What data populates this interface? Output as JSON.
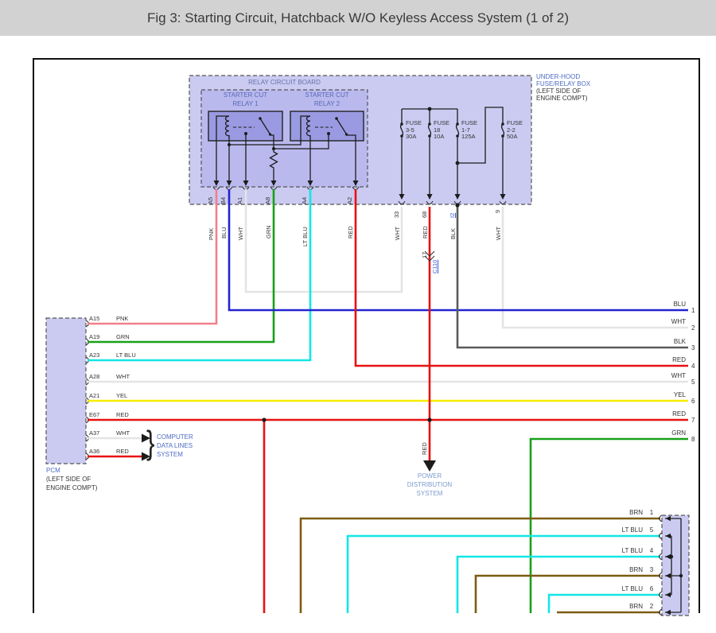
{
  "header": {
    "title": "Fig 3: Starting Circuit, Hatchback W/O Keyless Access System (1 of 2)"
  },
  "colors": {
    "pnk": "#f28089",
    "blu": "#2323d2",
    "wht": "#e4e4e4",
    "grn": "#18a018",
    "ltblu": "#12e6e6",
    "red": "#e81111",
    "yel": "#f6ec00",
    "blk": "#5a5a5a",
    "brn": "#7d5c12",
    "box_fill": "#cbcbf2",
    "board_fill": "#b9b9ee",
    "relay_fill": "#9a9ae2",
    "label_blue": "#4d6cc3",
    "link_blue": "#3c5cd0",
    "power_blue": "#7d9ace",
    "board_label": "#6671a8",
    "relay_label": "#5868b5",
    "line_dark": "#1c1c1c"
  },
  "relay_board": {
    "title": "RELAY CIRCUIT BOARD",
    "relays": [
      {
        "line1": "STARTER CUT",
        "line2": "RELAY 1"
      },
      {
        "line1": "STARTER CUT",
        "line2": "RELAY 2"
      }
    ],
    "pins": [
      {
        "id": "A5",
        "wire": "PNK"
      },
      {
        "id": "B4",
        "wire": "BLU"
      },
      {
        "id": "A1",
        "wire": "WHT"
      },
      {
        "id": "A8",
        "wire": "GRN"
      },
      {
        "id": "A4",
        "wire": "LT BLU"
      },
      {
        "id": "A2",
        "wire": "RED"
      }
    ]
  },
  "fuse_box": {
    "label": [
      "UNDER-HOOD",
      "FUSE/RELAY BOX",
      "(LEFT SIDE OF",
      "ENGINE COMPT)"
    ],
    "fuses": [
      {
        "title": "FUSE",
        "id": "3-5",
        "rating": "30A",
        "pin": "33",
        "wire": "WHT"
      },
      {
        "title": "FUSE",
        "id": "18",
        "rating": "10A",
        "pin": "68",
        "wire": "RED"
      },
      {
        "title": "FUSE",
        "id": "1-7",
        "rating": "125A",
        "pin": "I2",
        "wire": "BLK"
      },
      {
        "title": "FUSE",
        "id": "2-2",
        "rating": "50A",
        "pin": "9",
        "wire": "WHT"
      }
    ]
  },
  "c110": {
    "pin": "17",
    "id": "C110"
  },
  "pcm": {
    "label": [
      "PCM",
      "(LEFT SIDE OF",
      "ENGINE COMPT)"
    ],
    "pins": [
      {
        "id": "A15",
        "wire": "PNK"
      },
      {
        "id": "A19",
        "wire": "GRN"
      },
      {
        "id": "A23",
        "wire": "LT BLU"
      },
      {
        "id": "A28",
        "wire": "WHT"
      },
      {
        "id": "A21",
        "wire": "YEL"
      },
      {
        "id": "E67",
        "wire": "RED"
      },
      {
        "id": "A37",
        "wire": "WHT"
      },
      {
        "id": "A36",
        "wire": "RED"
      }
    ]
  },
  "computer_data": {
    "label": [
      "COMPUTER",
      "DATA LINES",
      "SYSTEM"
    ],
    "brace": "}"
  },
  "power_dist": {
    "label": [
      "POWER",
      "DISTRIBUTION",
      "SYSTEM"
    ]
  },
  "right_wires": [
    {
      "wire": "BLU",
      "num": "1"
    },
    {
      "wire": "WHT",
      "num": "2"
    },
    {
      "wire": "BLK",
      "num": "3"
    },
    {
      "wire": "RED",
      "num": "4"
    },
    {
      "wire": "WHT",
      "num": "5"
    },
    {
      "wire": "YEL",
      "num": "6"
    },
    {
      "wire": "RED",
      "num": "7"
    },
    {
      "wire": "GRN",
      "num": "8"
    }
  ],
  "bottom_wires": [
    {
      "wire": "BRN",
      "num": "1"
    },
    {
      "wire": "LT BLU",
      "num": "5"
    },
    {
      "wire": "LT BLU",
      "num": "4"
    },
    {
      "wire": "BRN",
      "num": "3"
    },
    {
      "wire": "LT BLU",
      "num": "6"
    },
    {
      "wire": "BRN",
      "num": "2"
    }
  ]
}
